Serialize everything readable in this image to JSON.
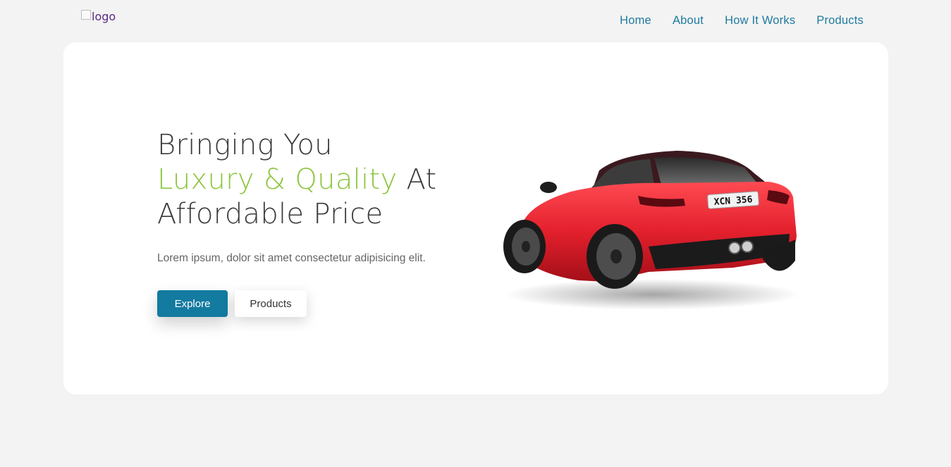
{
  "header": {
    "logo_alt": "logo",
    "nav": [
      {
        "label": "Home"
      },
      {
        "label": "About"
      },
      {
        "label": "How It Works"
      },
      {
        "label": "Products"
      }
    ]
  },
  "hero": {
    "title_line1": "Bringing You",
    "title_accent": "Luxury & Quality",
    "title_line2_rest": " At",
    "title_line3": "Affordable Price",
    "subtitle": "Lorem ipsum, dolor sit amet consectetur adipisicing elit.",
    "explore_label": "Explore",
    "products_label": "Products",
    "plate_text": "XCN 356"
  },
  "colors": {
    "accent_green": "#8dc63f",
    "primary_blue": "#137aa0",
    "nav_link": "#1f7aa0",
    "car_red": "#e3202d"
  }
}
